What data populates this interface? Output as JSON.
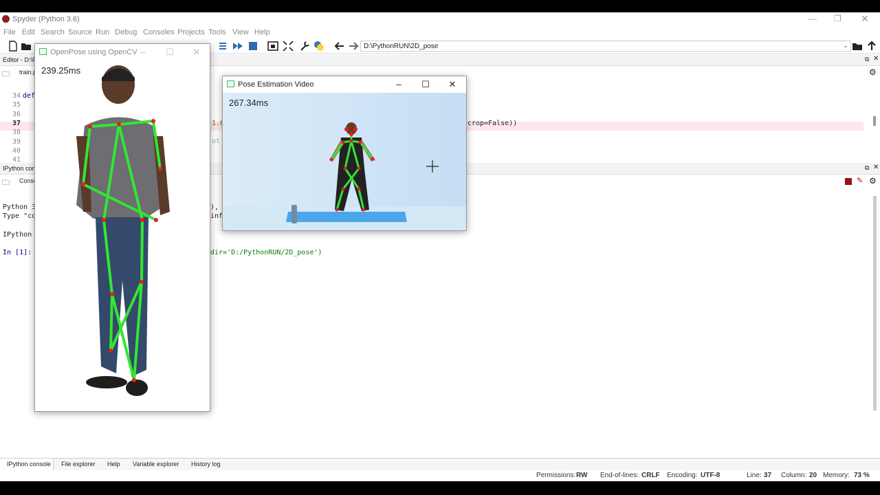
{
  "app": {
    "title": "Spyder (Python 3.6)",
    "menus": [
      "File",
      "Edit",
      "Search",
      "Source",
      "Run",
      "Debug",
      "Consoles",
      "Projects",
      "Tools",
      "View",
      "Help"
    ],
    "path": "D:\\PythonRUN\\2D_pose"
  },
  "editor": {
    "pane_title": "Editor - D:\\P",
    "tab": "train.p",
    "line_numbers": [
      "34",
      "35",
      "36",
      "37",
      "38",
      "39",
      "40",
      "41"
    ],
    "code_fragment_def": "def",
    "code_fragment_mid": "1.0",
    "code_fragment_mid2": "ut",
    "code_fragment_right": "crop=False))"
  },
  "console": {
    "pane_title": "IPython conso",
    "tab": "Conso",
    "line1": "Python 3",
    "line1_right": "),",
    "line2": "Type \"co",
    "line2_right": "info",
    "line3": "IPython",
    "prompt": "In [1]:",
    "prompt_right": "dir='D:/PythonRUN/2D_pose')"
  },
  "window_openpose": {
    "title": "OpenPose using OpenCV",
    "timing": "239.25ms"
  },
  "window_video": {
    "title": "Pose Estimation Video",
    "timing": "267.34ms"
  },
  "bottom_tabs": [
    "IPython console",
    "File explorer",
    "Help",
    "Variable explorer",
    "History log"
  ],
  "status": {
    "permissions_label": "Permissions:",
    "permissions": "RW",
    "eol_label": "End-of-lines:",
    "eol": "CRLF",
    "encoding_label": "Encoding:",
    "encoding": "UTF-8",
    "line_label": "Line:",
    "line": "37",
    "column_label": "Column:",
    "column": "20",
    "memory_label": "Memory:",
    "memory": "73 %"
  },
  "colors": {
    "skeleton": "#32e632",
    "joint": "#e02020",
    "video_bg": "#cfe6f7",
    "mat": "#4aa6e8"
  }
}
